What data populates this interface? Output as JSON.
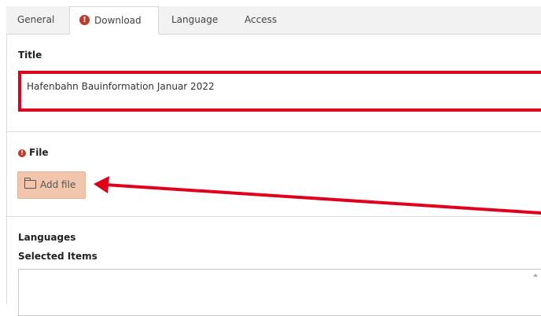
{
  "tabs": [
    {
      "label": "General",
      "active": false,
      "error": false
    },
    {
      "label": "Download",
      "active": true,
      "error": true
    },
    {
      "label": "Language",
      "active": false,
      "error": false
    },
    {
      "label": "Access",
      "active": false,
      "error": false
    }
  ],
  "error_glyph": "!",
  "title_field": {
    "label": "Title",
    "value": "Hafenbahn Bauinformation Januar 2022"
  },
  "file_field": {
    "label": "File",
    "add_button_label": "Add file"
  },
  "languages": {
    "label": "Languages",
    "selected_label": "Selected Items"
  },
  "colors": {
    "highlight": "#e0001b",
    "error": "#c0392b",
    "button_bg": "#f2c5ad"
  }
}
